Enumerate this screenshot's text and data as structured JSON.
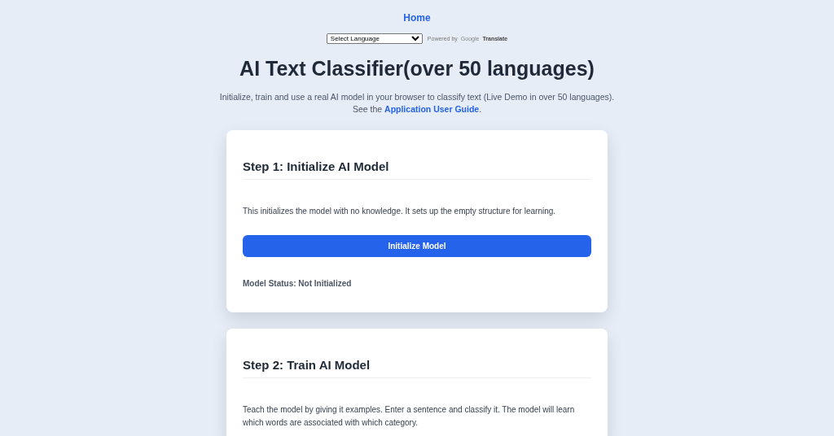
{
  "nav": {
    "home": "Home"
  },
  "translate": {
    "select": "Select Language",
    "powered_by": "Powered by",
    "brand": "Google",
    "product": "Translate"
  },
  "title": "AI Text Classifier(over 50 languages)",
  "intro": {
    "text": "Initialize, train and use a real AI model in your browser to classify text (Live Demo in over 50 languages).",
    "see": "See the",
    "link": "Application User Guide",
    "end": "."
  },
  "steps": [
    {
      "heading": "Step 1: Initialize AI Model",
      "text": "This initializes the model with no knowledge. It sets up the empty structure for learning.",
      "button": "Initialize Model",
      "status": "Model Status: Not Initialized"
    },
    {
      "heading": "Step 2: Train AI Model",
      "text": "Teach the model by giving it examples. Enter a sentence and classify it. The model will learn which words are associated with which category."
    }
  ]
}
